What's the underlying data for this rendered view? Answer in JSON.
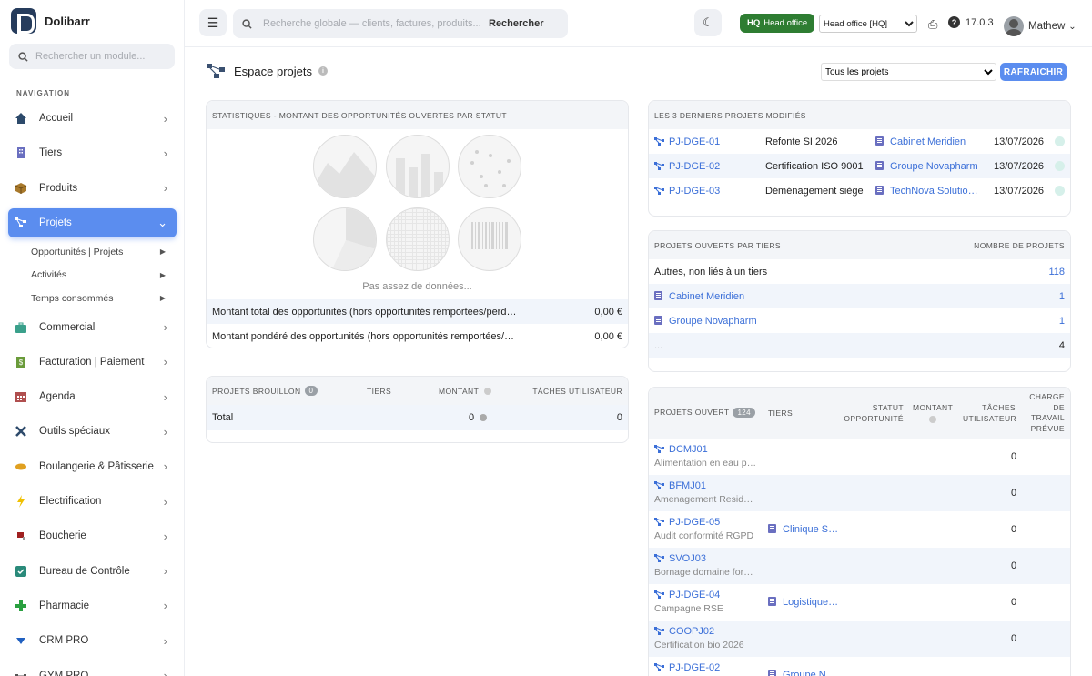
{
  "app": {
    "name": "Dolibarr"
  },
  "sidebar": {
    "search_placeholder": "Rechercher un module...",
    "section": "NAVIGATION",
    "items": [
      {
        "label": "Accueil",
        "icon": "home-icon",
        "color": "#2d4a6b"
      },
      {
        "label": "Tiers",
        "icon": "building-icon",
        "color": "#6a6fc0"
      },
      {
        "label": "Produits",
        "icon": "box-icon",
        "color": "#a8792b"
      },
      {
        "label": "Projets",
        "icon": "project-icon",
        "color": "#ffffff"
      },
      {
        "label": "Commercial",
        "icon": "briefcase-icon",
        "color": "#3aa08b"
      },
      {
        "label": "Facturation | Paiement",
        "icon": "invoice-icon",
        "color": "#6a9b3a"
      },
      {
        "label": "Agenda",
        "icon": "calendar-icon",
        "color": "#b04f4f"
      },
      {
        "label": "Outils spéciaux",
        "icon": "tools-icon",
        "color": "#2d4a6b"
      },
      {
        "label": "Boulangerie & Pâtisserie",
        "icon": "bread-icon",
        "color": "#e0a020"
      },
      {
        "label": "Electrification",
        "icon": "bolt-icon",
        "color": "#f0c000"
      },
      {
        "label": "Boucherie",
        "icon": "meat-icon",
        "color": "#a02020"
      },
      {
        "label": "Bureau de Contrôle",
        "icon": "shield-icon",
        "color": "#2a8a7a"
      },
      {
        "label": "Pharmacie",
        "icon": "cross-icon",
        "color": "#2aa040"
      },
      {
        "label": "CRM PRO",
        "icon": "funnel-icon",
        "color": "#2060c0"
      },
      {
        "label": "GYM PRO",
        "icon": "dumbbell-icon",
        "color": "#555555"
      }
    ],
    "sub_items": [
      {
        "label": "Opportunités | Projets"
      },
      {
        "label": "Activités"
      },
      {
        "label": "Temps consommés"
      }
    ]
  },
  "topbar": {
    "search_placeholder": "Recherche globale — clients, factures, produits...",
    "search_button": "Rechercher",
    "hq_badge_code": "HQ",
    "hq_badge_label": "Head office",
    "entity_selected": "Head office [HQ]",
    "version": "17.0.3",
    "user": "Mathew"
  },
  "main": {
    "title": "Espace projets",
    "filter_selected": "Tous les projets",
    "refresh_label": "RAFRAICHIR",
    "stats": {
      "header": "STATISTIQUES - MONTANT DES OPPORTUNITÉS OUVERTES PAR STATUT",
      "empty": "Pas assez de données...",
      "rows": [
        {
          "label": "Montant total des opportunités (hors opportunités remportées/perd…",
          "value": "0,00 €"
        },
        {
          "label": "Montant pondéré des opportunités (hors opportunités remportées/…",
          "value": "0,00 €"
        }
      ]
    },
    "drafts": {
      "header": "PROJETS BROUILLON",
      "count": "0",
      "col_tiers": "TIERS",
      "col_amount": "MONTANT",
      "col_tasks": "TÂCHES UTILISATEUR",
      "total_label": "Total",
      "total_amount": "0",
      "total_tasks": "0"
    },
    "last_modified": {
      "header": "LES 3 DERNIERS PROJETS MODIFIÉS",
      "rows": [
        {
          "ref": "PJ-DGE-01",
          "title": "Refonte SI 2026",
          "thirdparty": "Cabinet Meridien",
          "date": "13/07/2026"
        },
        {
          "ref": "PJ-DGE-02",
          "title": "Certification ISO 9001",
          "thirdparty": "Groupe Novapharm",
          "date": "13/07/2026"
        },
        {
          "ref": "PJ-DGE-03",
          "title": "Déménagement siège",
          "thirdparty": "TechNova Solutio…",
          "date": "13/07/2026"
        }
      ]
    },
    "by_thirdparty": {
      "header": "PROJETS OUVERTS PAR TIERS",
      "header_count": "NOMBRE DE PROJETS",
      "rows": [
        {
          "label": "Autres, non liés à un tiers",
          "count": "118",
          "link": false
        },
        {
          "label": "Cabinet Meridien",
          "count": "1",
          "link": true
        },
        {
          "label": "Groupe Novapharm",
          "count": "1",
          "link": true
        },
        {
          "label": "...",
          "count": "4",
          "link": false
        }
      ]
    },
    "open_projects": {
      "header": "PROJETS OUVERT",
      "count": "124",
      "col_tiers": "TIERS",
      "col_status_1": "STATUT",
      "col_status_2": "OPPORTUNITÉ",
      "col_amount": "MONTANT",
      "col_tasks_1": "TÂCHES",
      "col_tasks_2": "UTILISATEUR",
      "col_charge_1": "CHARGE",
      "col_charge_2": "DE",
      "col_charge_3": "TRAVAIL",
      "col_charge_4": "PRÉVUE",
      "rows": [
        {
          "ref": "DCMJ01",
          "desc": "Alimentation en eau p…",
          "tiers": "",
          "tasks": "0"
        },
        {
          "ref": "BFMJ01",
          "desc": "Amenagement Resid…",
          "tiers": "",
          "tasks": "0"
        },
        {
          "ref": "PJ-DGE-05",
          "desc": "Audit conformité RGPD",
          "tiers": "Clinique S…",
          "tasks": "0"
        },
        {
          "ref": "SVOJ03",
          "desc": "Bornage domaine for…",
          "tiers": "",
          "tasks": "0"
        },
        {
          "ref": "PJ-DGE-04",
          "desc": "Campagne RSE",
          "tiers": "Logistique…",
          "tasks": "0"
        },
        {
          "ref": "COOPJ02",
          "desc": "Certification bio 2026",
          "tiers": "",
          "tasks": "0"
        },
        {
          "ref": "PJ-DGE-02",
          "desc": "",
          "tiers": "Groupe N…",
          "tasks": ""
        }
      ]
    }
  },
  "colors": {
    "accent": "#5b8def",
    "hq_green": "#2e7d32",
    "link": "#3b6fd8"
  }
}
